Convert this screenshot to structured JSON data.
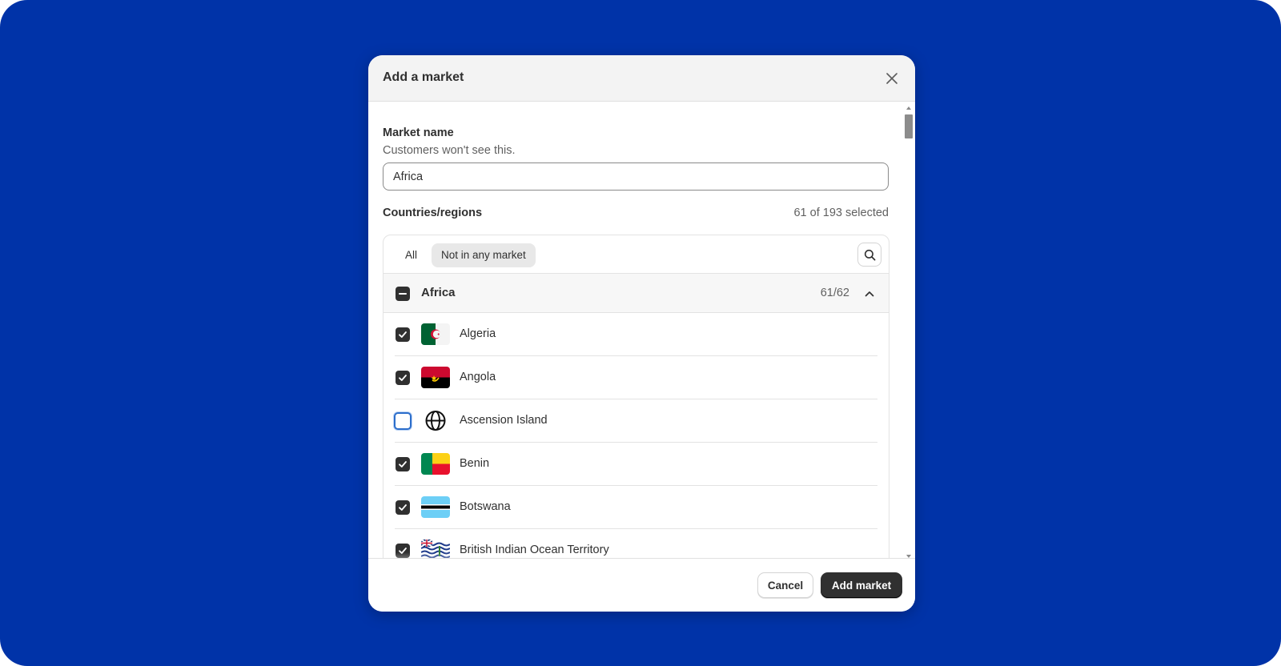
{
  "modal": {
    "title": "Add a market"
  },
  "market_name": {
    "label": "Market name",
    "help": "Customers won't see this.",
    "value": "Africa"
  },
  "regions": {
    "label": "Countries/regions",
    "selected_count": "61 of 193 selected",
    "filters": [
      {
        "label": "All",
        "active": false
      },
      {
        "label": "Not in any market",
        "active": true
      }
    ],
    "group": {
      "name": "Africa",
      "count": "61/62",
      "state": "indeterminate"
    },
    "countries": [
      {
        "name": "Algeria",
        "checked": true,
        "flag": "algeria-flag-icon"
      },
      {
        "name": "Angola",
        "checked": true,
        "flag": "angola-flag-icon"
      },
      {
        "name": "Ascension Island",
        "checked": false,
        "flag": "globe-icon"
      },
      {
        "name": "Benin",
        "checked": true,
        "flag": "benin-flag-icon"
      },
      {
        "name": "Botswana",
        "checked": true,
        "flag": "botswana-flag-icon"
      },
      {
        "name": "British Indian Ocean Territory",
        "checked": true,
        "flag": "british-indian-ocean-territory-flag-icon"
      }
    ]
  },
  "footer": {
    "cancel_label": "Cancel",
    "submit_label": "Add market"
  },
  "colors": {
    "background": "#0033a8",
    "primary_button": "#303030",
    "focus_ring": "#2c6ecb"
  }
}
